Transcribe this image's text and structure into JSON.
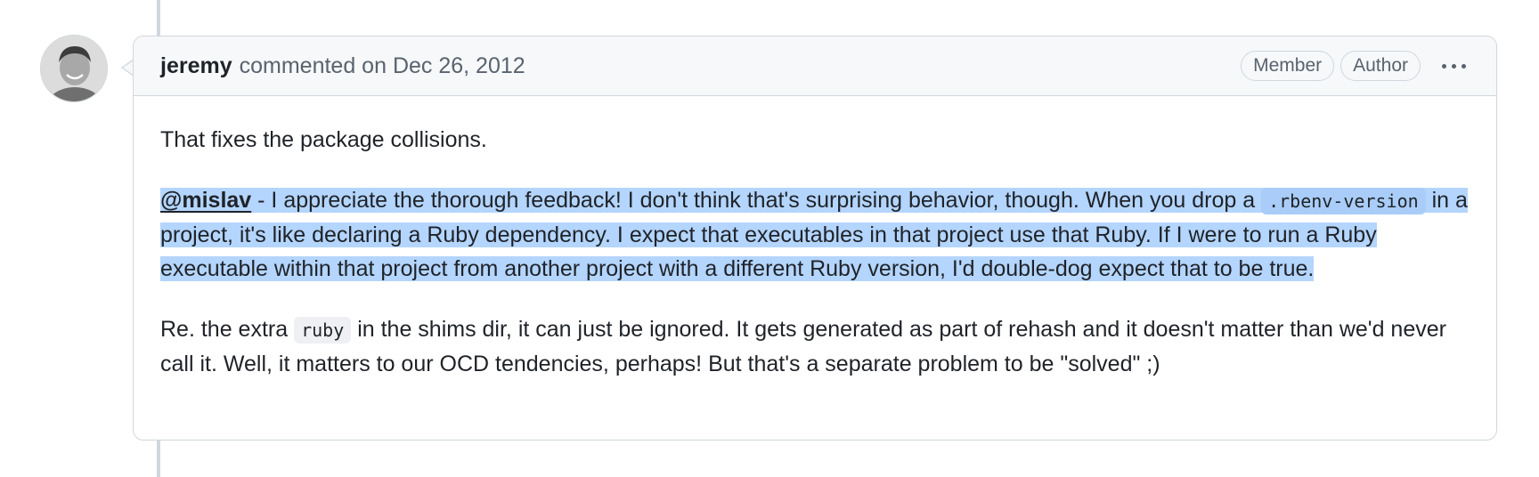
{
  "comment": {
    "author": "jeremy",
    "meta_text": "commented on Dec 26, 2012",
    "labels": [
      "Member",
      "Author"
    ],
    "menu_icon": "kebab-horizontal-icon",
    "paragraph1": "That fixes the package collisions.",
    "paragraph2": {
      "mention": "@mislav",
      "text_a": " - I appreciate the thorough feedback! I don't think that's surprising behavior, though. When you drop a ",
      "code": ".rbenv-version",
      "text_b": " in a project, it's like declaring a Ruby dependency. I expect that executables in that project use that Ruby. If I were to run a Ruby executable within that project from another project with a different Ruby version, I'd double-dog expect that to be true."
    },
    "paragraph3": {
      "text_a": "Re. the extra ",
      "code": "ruby",
      "text_b": " in the shims dir, it can just be ignored. It gets generated as part of rehash and it doesn't matter than we'd never call it. Well, it matters to our OCD tendencies, perhaps! But that's a separate problem to be \"solved\" ;)"
    }
  },
  "colors": {
    "selection": "#b4d5fe",
    "border": "#d0d7de",
    "header_bg": "#f6f8fa",
    "muted_text": "#59636e"
  }
}
